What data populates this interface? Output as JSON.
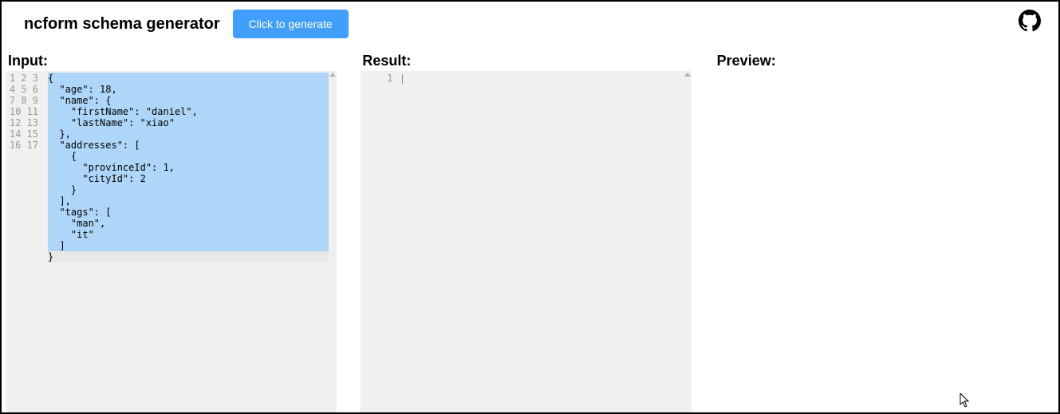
{
  "header": {
    "title": "ncform schema generator",
    "generate_label": "Click to generate"
  },
  "panels": {
    "input_label": "Input:",
    "result_label": "Result:",
    "preview_label": "Preview:"
  },
  "input_editor": {
    "line_count": 17,
    "active_line": 17,
    "lines": [
      "{",
      "  \"age\": 18,",
      "  \"name\": {",
      "    \"firstName\": \"daniel\",",
      "    \"lastName\": \"xiao\"",
      "  },",
      "  \"addresses\": [",
      "    {",
      "      \"provinceId\": 1,",
      "      \"cityId\": 2",
      "    }",
      "  ],",
      "  \"tags\": [",
      "    \"man\",",
      "    \"it\"",
      "  ]",
      "}"
    ]
  },
  "result_editor": {
    "line_count": 1,
    "lines": [
      ""
    ]
  }
}
